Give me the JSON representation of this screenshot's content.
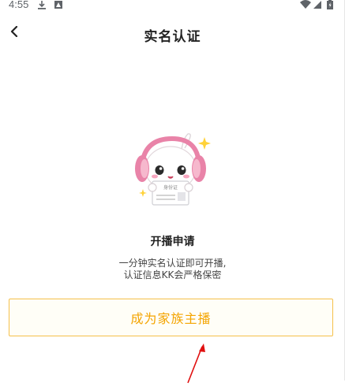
{
  "status_bar": {
    "time": "4:55",
    "icons": [
      "download-icon",
      "notification-icon",
      "wifi-icon",
      "signal-icon",
      "battery-icon"
    ]
  },
  "nav": {
    "title": "实名认证",
    "back_icon": "chevron-left-icon"
  },
  "content": {
    "mascot_icon": "mascot-headphones-icon",
    "mascot_card_text": "身份证",
    "title": "开播申请",
    "desc_line1": "一分钟实名认证即可开播,",
    "desc_line2": "认证信息KK会严格保密"
  },
  "action": {
    "button_label": "成为家族主播"
  },
  "colors": {
    "accent": "#f4a400",
    "button_border": "#f5c04a",
    "mascot_pink": "#e983a8",
    "arrow_red": "#e01010"
  }
}
